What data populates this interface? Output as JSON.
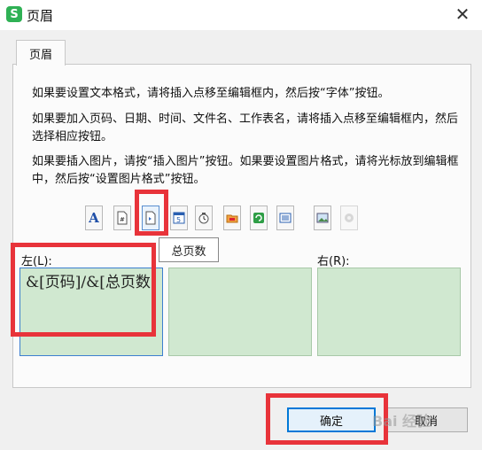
{
  "window": {
    "app_icon_glyph": "S",
    "title": "页眉",
    "close_glyph": "✕"
  },
  "tab": {
    "label": "页眉"
  },
  "instructions": [
    "如果要设置文本格式，请将插入点移至编辑框内，然后按“字体”按钮。",
    "如果要加入页码、日期、时间、文件名、工作表名，请将插入点移至编辑框内，然后选择相应按钮。",
    "如果要插入图片，请按“插入图片”按钮。如果要设置图片格式，请将光标放到编辑框中，然后按“设置图片格式”按钮。"
  ],
  "toolbar": {
    "font": "A",
    "page_number": "#",
    "total_pages": "",
    "date": "5",
    "time": "",
    "file_path": "",
    "file_name": "",
    "sheet_name": "",
    "insert_picture": "",
    "format_picture": ""
  },
  "tooltip": "总页数",
  "sections": {
    "left": {
      "label": "左(L):",
      "content": "&[页码]/&[总页数]"
    },
    "center": {
      "label": "",
      "content": ""
    },
    "right": {
      "label": "右(R):",
      "content": ""
    }
  },
  "buttons": {
    "ok": "确定",
    "cancel": "取消"
  },
  "watermark": "Bai 经验",
  "colors": {
    "highlight": "#e8333a",
    "editor_bg": "#d0e8d0",
    "primary_border": "#0078d7",
    "app_icon": "#2fb155"
  }
}
